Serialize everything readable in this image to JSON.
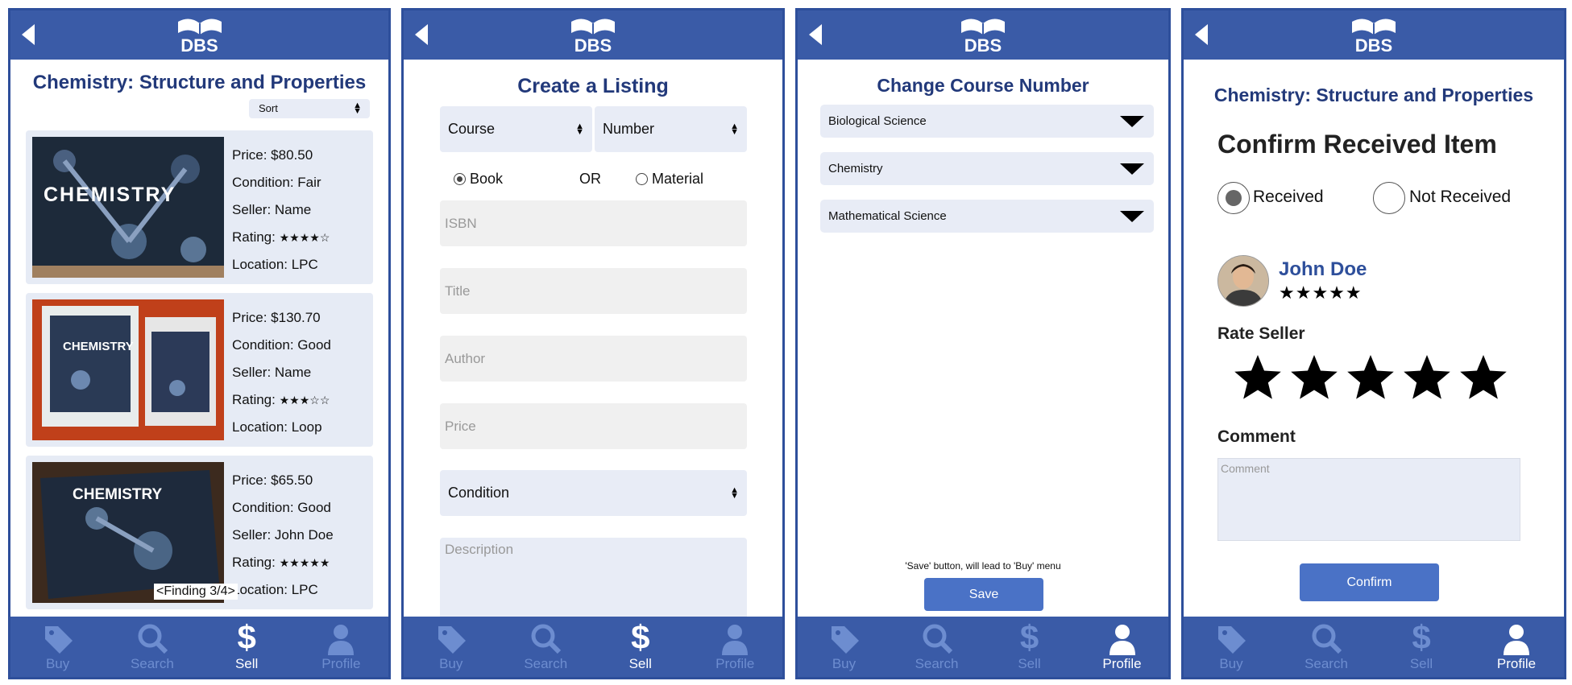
{
  "common": {
    "logo_text": "DBS"
  },
  "nav": {
    "buy": "Buy",
    "search": "Search",
    "sell": "Sell",
    "profile": "Profile"
  },
  "screen1": {
    "title": "Chemistry: Structure and Properties",
    "sort_label": "Sort",
    "finding": "<Finding 3/4>",
    "listings": [
      {
        "price": "Price: $80.50",
        "condition": "Condition: Fair",
        "seller": "Seller: Name",
        "rating_label": "Rating:",
        "rating": 4,
        "location": "Location: LPC",
        "cover_text": "CHEMISTRY"
      },
      {
        "price": "Price: $130.70",
        "condition": "Condition: Good",
        "seller": "Seller: Name",
        "rating_label": "Rating:",
        "rating": 3,
        "location": "Location: Loop",
        "cover_text": "CHEMISTRY"
      },
      {
        "price": "Price: $65.50",
        "condition": "Condition: Good",
        "seller": "Seller: John Doe",
        "rating_label": "Rating:",
        "rating": 5,
        "location": "Location: LPC",
        "cover_text": "CHEMISTRY"
      }
    ]
  },
  "screen2": {
    "title": "Create a Listing",
    "course": "Course",
    "number": "Number",
    "book": "Book",
    "or": "OR",
    "material": "Material",
    "isbn": "ISBN",
    "title_field": "Title",
    "author": "Author",
    "price": "Price",
    "condition": "Condition",
    "description": "Description"
  },
  "screen3": {
    "title": "Change Course Number",
    "courses": [
      "Biological Science",
      "Chemistry",
      "Mathematical Science"
    ],
    "note": "'Save' button, will lead to 'Buy' menu",
    "save": "Save"
  },
  "screen4": {
    "title": "Chemistry: Structure and Properties",
    "confirm_heading": "Confirm Received Item",
    "received": "Received",
    "not_received": "Not Received",
    "seller_name": "John Doe",
    "seller_rating": 5,
    "rate_seller": "Rate Seller",
    "rate_value": 5,
    "comment_label": "Comment",
    "comment_placeholder": "Comment",
    "confirm": "Confirm"
  },
  "colors": {
    "brand": "#3a5ba7",
    "title": "#22397a",
    "button": "#4a72c6",
    "nav_inactive": "#6d8dd0"
  }
}
